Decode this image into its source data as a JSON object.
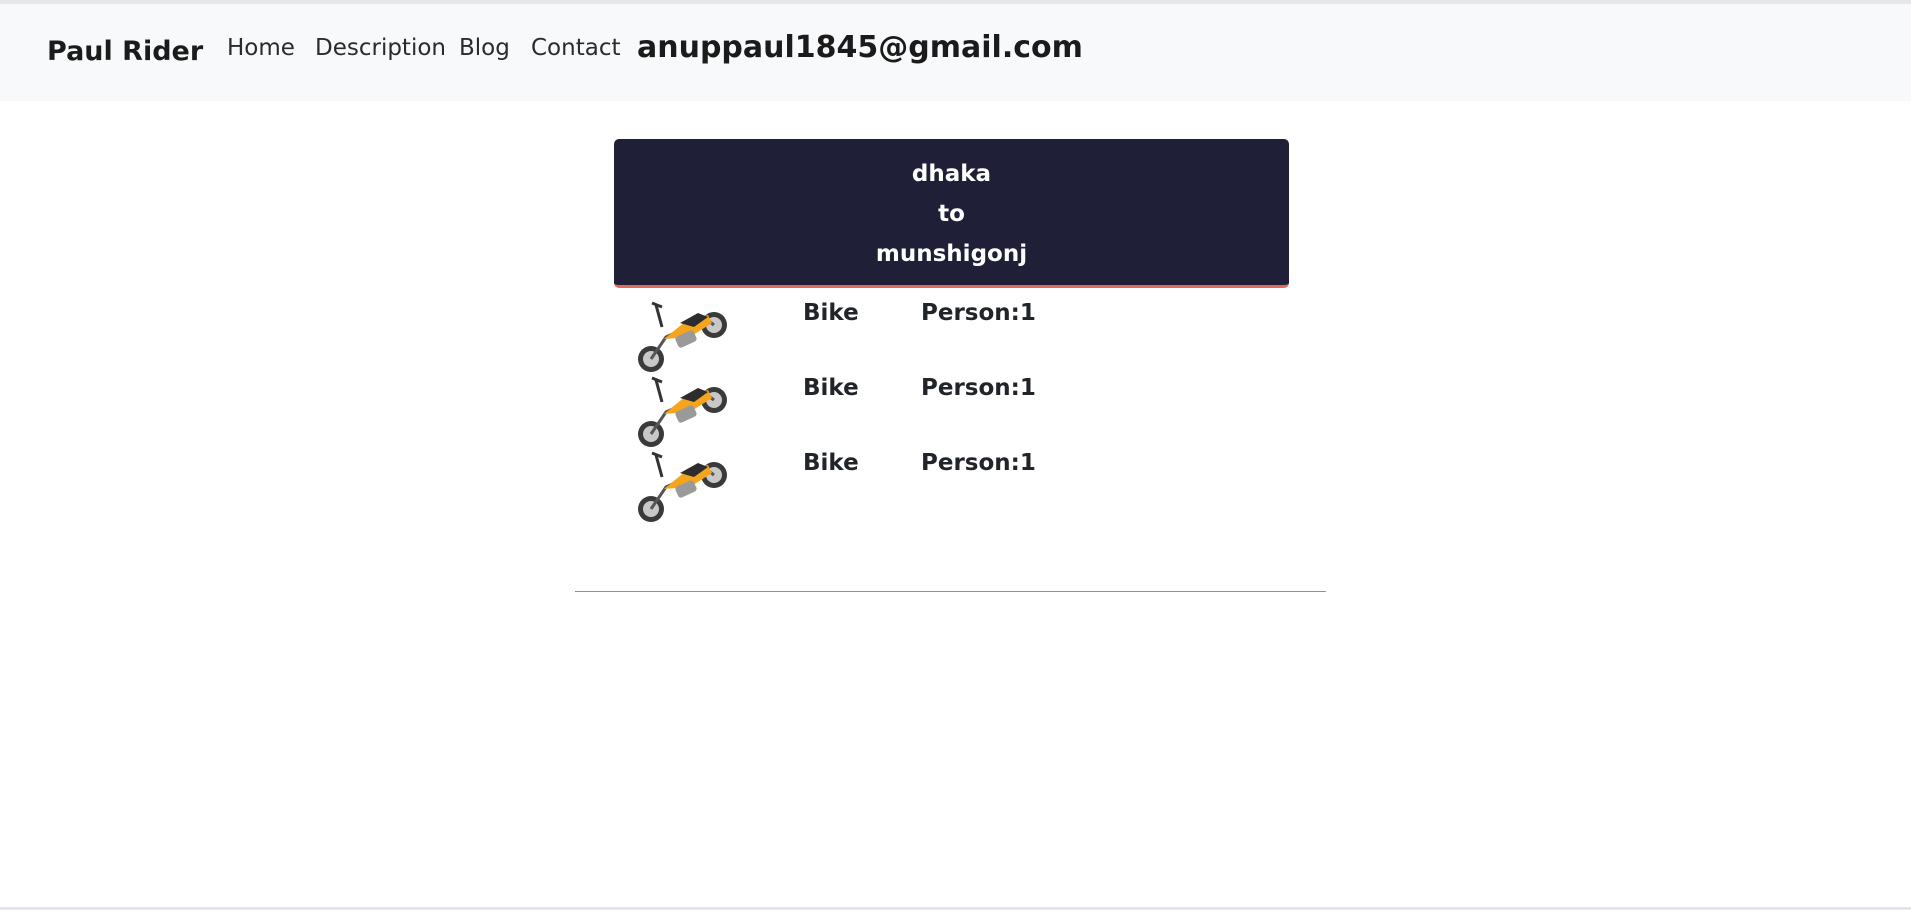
{
  "navbar": {
    "brand": "Paul Rider",
    "links": [
      "Home",
      "Description",
      "Blog",
      "Contact"
    ],
    "email": "anuppaul1845@gmail.com"
  },
  "route": {
    "from": "dhaka",
    "connector": "to",
    "to": "munshigonj"
  },
  "rides": [
    {
      "type": "Bike",
      "person": "Person:1",
      "icon": "motorcycle-icon"
    },
    {
      "type": "Bike",
      "person": "Person:1",
      "icon": "motorcycle-icon"
    },
    {
      "type": "Bike",
      "person": "Person:1",
      "icon": "motorcycle-icon"
    }
  ],
  "colors": {
    "card_bg": "#1f2037",
    "card_accent": "#e8675a",
    "divider": "#b8941c",
    "navbar_bg": "#f8f9fa",
    "bike_body": "#f4a51c"
  }
}
